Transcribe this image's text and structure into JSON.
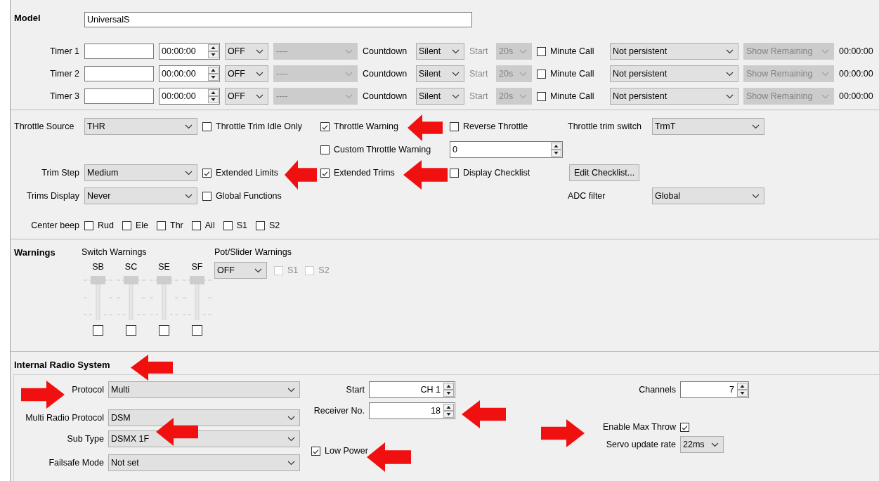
{
  "model": {
    "label": "Model",
    "name": "UniversalS"
  },
  "timers": [
    {
      "label": "Timer 1",
      "time": "00:00:00",
      "mode": "OFF",
      "switch": {
        "value": "----",
        "disabled": true
      },
      "countdown_label": "Countdown",
      "countdown": "Silent",
      "start_label": "Start",
      "start": {
        "value": "20s",
        "disabled": true
      },
      "minute_call": {
        "label": "Minute Call",
        "checked": false
      },
      "persistence": "Not persistent",
      "display": {
        "value": "Show Remaining",
        "disabled": true
      },
      "elapsed": "00:00:00"
    },
    {
      "label": "Timer 2",
      "time": "00:00:00",
      "mode": "OFF",
      "switch": {
        "value": "----",
        "disabled": true
      },
      "countdown_label": "Countdown",
      "countdown": "Silent",
      "start_label": "Start",
      "start": {
        "value": "20s",
        "disabled": true
      },
      "minute_call": {
        "label": "Minute Call",
        "checked": false
      },
      "persistence": "Not persistent",
      "display": {
        "value": "Show Remaining",
        "disabled": true
      },
      "elapsed": "00:00:00"
    },
    {
      "label": "Timer 3",
      "time": "00:00:00",
      "mode": "OFF",
      "switch": {
        "value": "----",
        "disabled": true
      },
      "countdown_label": "Countdown",
      "countdown": "Silent",
      "start_label": "Start",
      "start": {
        "value": "20s",
        "disabled": true
      },
      "minute_call": {
        "label": "Minute Call",
        "checked": false
      },
      "persistence": "Not persistent",
      "display": {
        "value": "Show Remaining",
        "disabled": true
      },
      "elapsed": "00:00:00"
    }
  ],
  "setup": {
    "throttle_source": {
      "label": "Throttle Source",
      "value": "THR"
    },
    "throttle_trim_idle_only": {
      "label": "Throttle Trim Idle Only",
      "checked": false
    },
    "throttle_warning": {
      "label": "Throttle Warning",
      "checked": true
    },
    "reverse_throttle": {
      "label": "Reverse Throttle",
      "checked": false
    },
    "throttle_trim_switch": {
      "label": "Throttle trim switch",
      "value": "TrmT"
    },
    "custom_throttle_warning": {
      "label": "Custom Throttle Warning",
      "checked": false,
      "value": "0"
    },
    "trim_step": {
      "label": "Trim Step",
      "value": "Medium"
    },
    "extended_limits": {
      "label": "Extended Limits",
      "checked": true
    },
    "extended_trims": {
      "label": "Extended Trims",
      "checked": true
    },
    "display_checklist": {
      "label": "Display Checklist",
      "checked": false
    },
    "edit_checklist": "Edit Checklist...",
    "trims_display": {
      "label": "Trims Display",
      "value": "Never"
    },
    "global_functions": {
      "label": "Global Functions",
      "checked": false
    },
    "adc_filter": {
      "label": "ADC filter",
      "value": "Global"
    },
    "center_beep": {
      "label": "Center beep",
      "channels": [
        {
          "label": "Rud",
          "checked": false
        },
        {
          "label": "Ele",
          "checked": false
        },
        {
          "label": "Thr",
          "checked": false
        },
        {
          "label": "Ail",
          "checked": false
        },
        {
          "label": "S1",
          "checked": false
        },
        {
          "label": "S2",
          "checked": false
        }
      ]
    }
  },
  "warnings": {
    "title": "Warnings",
    "switch_title": "Switch Warnings",
    "switches": [
      {
        "label": "SB",
        "level": 1,
        "checked": false
      },
      {
        "label": "SC",
        "level": 1,
        "checked": false
      },
      {
        "label": "SE",
        "level": 1,
        "checked": false
      },
      {
        "label": "SF",
        "level": 1,
        "checked": false
      }
    ],
    "pot_title": "Pot/Slider Warnings",
    "pot_mode": "OFF",
    "pots": [
      {
        "label": "S1",
        "checked": false,
        "disabled": true
      },
      {
        "label": "S2",
        "checked": false,
        "disabled": true
      }
    ]
  },
  "radio": {
    "title": "Internal Radio System",
    "protocol": {
      "label": "Protocol",
      "value": "Multi"
    },
    "multi_protocol": {
      "label": "Multi Radio Protocol",
      "value": "DSM"
    },
    "sub_type": {
      "label": "Sub Type",
      "value": "DSMX 1F"
    },
    "failsafe": {
      "label": "Failsafe Mode",
      "value": "Not set"
    },
    "start": {
      "label": "Start",
      "value": "CH 1"
    },
    "receiver": {
      "label": "Receiver No.",
      "value": "18"
    },
    "low_power": {
      "label": "Low Power",
      "checked": true
    },
    "channels": {
      "label": "Channels",
      "value": "7"
    },
    "max_throw": {
      "label": "Enable Max Throw",
      "checked": true
    },
    "servo_rate": {
      "label": "Servo update rate",
      "value": "22ms"
    }
  }
}
